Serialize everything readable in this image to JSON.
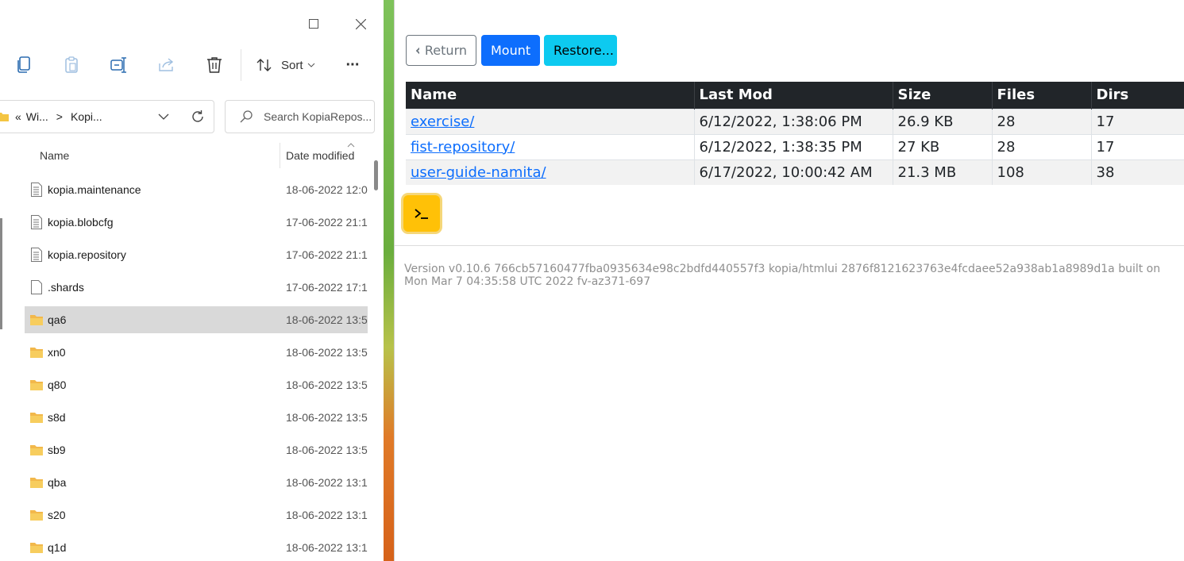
{
  "explorer": {
    "window_controls": {
      "maximize": "☐",
      "close": "✕"
    },
    "toolbar": {
      "sort_label": "Sort",
      "more_label": "···"
    },
    "address": {
      "overflow": "«",
      "crumb1": "Wi...",
      "sep": ">",
      "crumb2": "Kopi..."
    },
    "search": {
      "placeholder": "Search KopiaRepos..."
    },
    "columns": {
      "name": "Name",
      "date": "Date modified"
    },
    "files": [
      {
        "name": "kopia.maintenance",
        "date": "18-06-2022 12:0",
        "icon": "document-icon"
      },
      {
        "name": "kopia.blobcfg",
        "date": "17-06-2022 21:1",
        "icon": "document-icon"
      },
      {
        "name": "kopia.repository",
        "date": "17-06-2022 21:1",
        "icon": "document-icon"
      },
      {
        "name": ".shards",
        "date": "17-06-2022 17:1",
        "icon": "file-icon"
      },
      {
        "name": "qa6",
        "date": "18-06-2022 13:5",
        "icon": "folder-icon"
      },
      {
        "name": "xn0",
        "date": "18-06-2022 13:5",
        "icon": "folder-icon"
      },
      {
        "name": "q80",
        "date": "18-06-2022 13:5",
        "icon": "folder-icon"
      },
      {
        "name": "s8d",
        "date": "18-06-2022 13:5",
        "icon": "folder-icon"
      },
      {
        "name": "sb9",
        "date": "18-06-2022 13:5",
        "icon": "folder-icon"
      },
      {
        "name": "qba",
        "date": "18-06-2022 13:1",
        "icon": "folder-icon"
      },
      {
        "name": "s20",
        "date": "18-06-2022 13:1",
        "icon": "folder-icon"
      },
      {
        "name": "q1d",
        "date": "18-06-2022 13:1",
        "icon": "folder-icon"
      }
    ]
  },
  "kopia": {
    "buttons": {
      "return": "Return",
      "mount": "Mount",
      "restore": "Restore..."
    },
    "table": {
      "headers": [
        "Name",
        "Last Mod",
        "Size",
        "Files",
        "Dirs"
      ],
      "rows": [
        {
          "name": "exercise/",
          "last_mod": "6/12/2022, 1:38:06 PM",
          "size": "26.9 KB",
          "files": "28",
          "dirs": "17"
        },
        {
          "name": "fist-repository/",
          "last_mod": "6/12/2022, 1:38:35 PM",
          "size": "27 KB",
          "files": "28",
          "dirs": "17"
        },
        {
          "name": "user-guide-namita/",
          "last_mod": "6/17/2022, 10:00:42 AM",
          "size": "21.3 MB",
          "files": "108",
          "dirs": "38"
        }
      ]
    },
    "version": "Version v0.10.6 766cb57160477fba0935634e98c2bdfd440557f3 kopia/htmlui 2876f8121623763e4fcdaee52a938ab1a8989d1a built on Mon Mar 7 04:35:58 UTC 2022 fv-az371-697"
  },
  "colors": {
    "primary": "#0d6efd",
    "info": "#0dcaf0",
    "warning": "#ffc107",
    "table_header": "#212529"
  }
}
